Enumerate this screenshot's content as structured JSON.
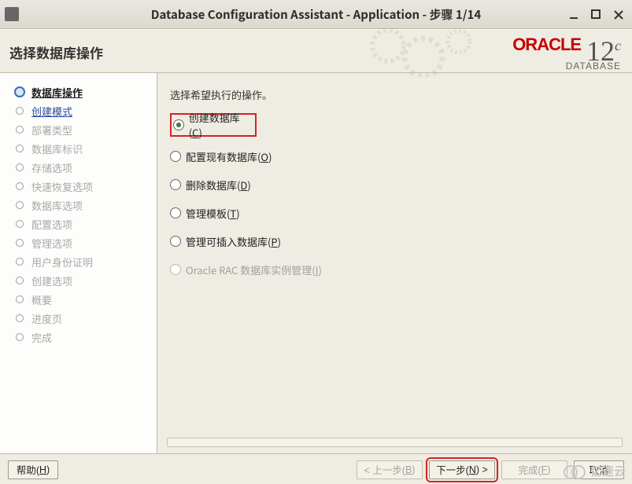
{
  "window": {
    "title": "Database Configuration Assistant - Application - 步骤 1/14"
  },
  "header": {
    "title": "选择数据库操作",
    "brand_main": "ORACLE",
    "brand_sub": "DATABASE",
    "brand_version": "12",
    "brand_version_sup": "c"
  },
  "sidebar": {
    "steps": [
      {
        "label": "数据库操作",
        "state": "current"
      },
      {
        "label": "创建模式",
        "state": "link"
      },
      {
        "label": "部署类型",
        "state": "disabled"
      },
      {
        "label": "数据库标识",
        "state": "disabled"
      },
      {
        "label": "存储选项",
        "state": "disabled"
      },
      {
        "label": "快速恢复选项",
        "state": "disabled"
      },
      {
        "label": "数据库选项",
        "state": "disabled"
      },
      {
        "label": "配置选项",
        "state": "disabled"
      },
      {
        "label": "管理选项",
        "state": "disabled"
      },
      {
        "label": "用户身份证明",
        "state": "disabled"
      },
      {
        "label": "创建选项",
        "state": "disabled"
      },
      {
        "label": "概要",
        "state": "disabled"
      },
      {
        "label": "进度页",
        "state": "disabled"
      },
      {
        "label": "完成",
        "state": "disabled"
      }
    ]
  },
  "main": {
    "prompt": "选择希望执行的操作。",
    "options": [
      {
        "label": "创建数据库",
        "mnemonic": "C",
        "selected": true,
        "highlight": true,
        "disabled": false
      },
      {
        "label": "配置现有数据库",
        "mnemonic": "O",
        "selected": false,
        "highlight": false,
        "disabled": false
      },
      {
        "label": "删除数据库",
        "mnemonic": "D",
        "selected": false,
        "highlight": false,
        "disabled": false
      },
      {
        "label": "管理模板",
        "mnemonic": "T",
        "selected": false,
        "highlight": false,
        "disabled": false
      },
      {
        "label": "管理可插入数据库",
        "mnemonic": "P",
        "selected": false,
        "highlight": false,
        "disabled": false
      },
      {
        "label": "Oracle RAC 数据库实例管理",
        "mnemonic": "I",
        "selected": false,
        "highlight": false,
        "disabled": true
      }
    ]
  },
  "footer": {
    "help": {
      "label": "帮助",
      "mnemonic": "H",
      "enabled": true,
      "highlight": false
    },
    "back": {
      "label": "< 上一步",
      "mnemonic": "B",
      "enabled": false,
      "highlight": false
    },
    "next": {
      "label": "下一步",
      "suffix": " >",
      "mnemonic": "N",
      "enabled": true,
      "highlight": true
    },
    "finish": {
      "label": "完成",
      "mnemonic": "F",
      "enabled": false,
      "highlight": false
    },
    "cancel": {
      "label": "取消",
      "mnemonic": "",
      "enabled": true,
      "highlight": false
    }
  },
  "watermark": "亿速云"
}
